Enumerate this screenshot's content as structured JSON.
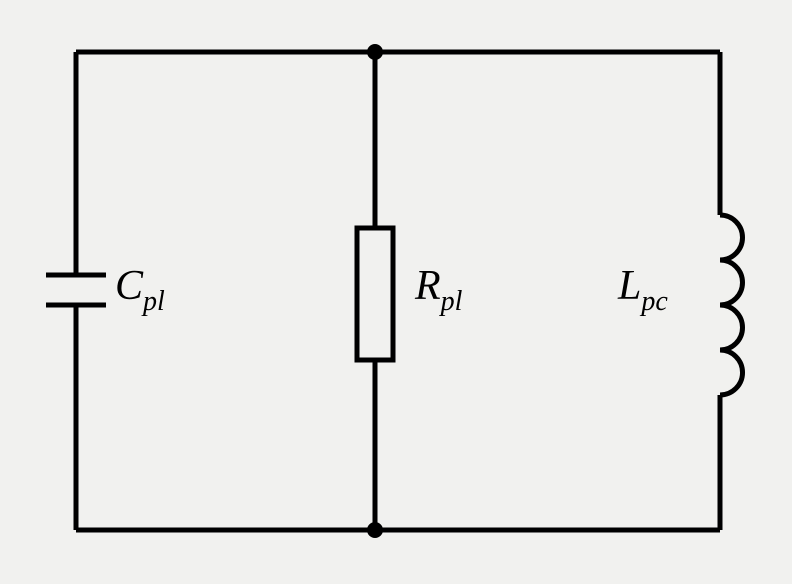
{
  "components": {
    "capacitor": {
      "symbol": "C",
      "subscript": "pl"
    },
    "resistor": {
      "symbol": "R",
      "subscript": "pl"
    },
    "inductor": {
      "symbol": "L",
      "subscript": "pc"
    }
  }
}
